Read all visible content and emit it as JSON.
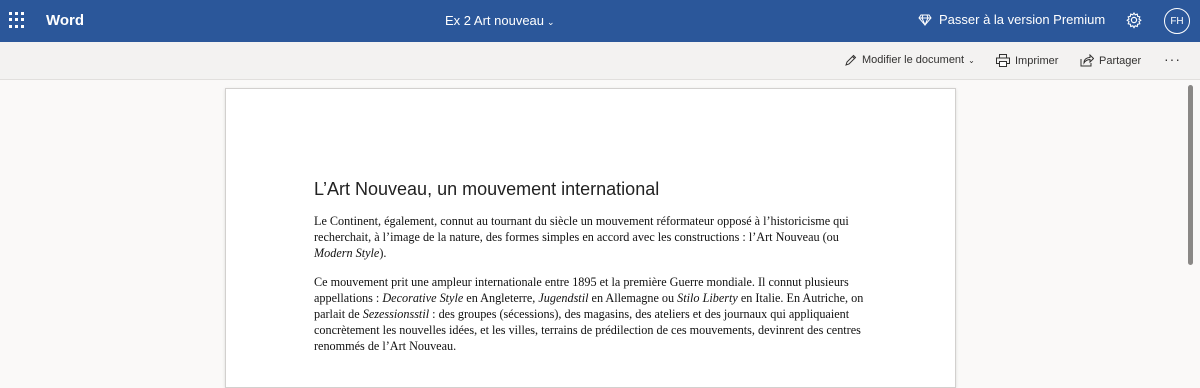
{
  "topbar": {
    "app_name": "Word",
    "doc_title": "Ex 2 Art nouveau",
    "premium_label": "Passer à la version Premium",
    "avatar_initials": "FH",
    "bg_color": "#2b579a"
  },
  "commandbar": {
    "edit_label": "Modifier le document",
    "print_label": "Imprimer",
    "share_label": "Partager",
    "more_label": "···"
  },
  "document": {
    "heading": "L’Art Nouveau, un mouvement international",
    "paragraph1": [
      {
        "t": "Le Continent, également, connut au tournant du siècle un mouvement réformateur opposé à l’historicisme qui recherchait, à l’image de la nature, des formes simples en accord avec les constructions : l’Art Nouveau (ou ",
        "i": false
      },
      {
        "t": "Modern Style",
        "i": true
      },
      {
        "t": ").",
        "i": false
      }
    ],
    "paragraph2": [
      {
        "t": "Ce mouvement prit une ampleur internationale entre 1895 et la première Guerre mondiale. Il connut plusieurs appellations : ",
        "i": false
      },
      {
        "t": "Decorative Style",
        "i": true
      },
      {
        "t": " en Angleterre, ",
        "i": false
      },
      {
        "t": "Jugendstil",
        "i": true
      },
      {
        "t": " en Allemagne ou ",
        "i": false
      },
      {
        "t": "Stilo Liberty",
        "i": true
      },
      {
        "t": " en Italie. En Autriche, on parlait de ",
        "i": false
      },
      {
        "t": "Sezessionsstil",
        "i": true
      },
      {
        "t": " : des groupes (sécessions), des magasins, des ateliers et des journaux qui appliquaient concrètement les nouvelles idées, et les villes, terrains de prédilection de ces mouvements, devinrent des centres renommés de l’Art Nouveau.",
        "i": false
      }
    ]
  }
}
